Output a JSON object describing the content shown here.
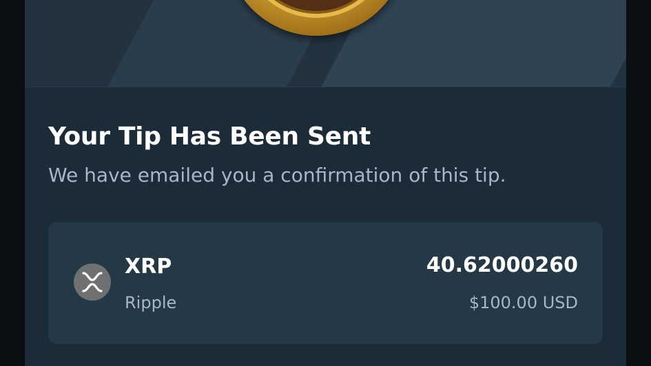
{
  "confirmation": {
    "title": "Your Tip Has Been Sent",
    "message": "We have emailed you a confirmation of this tip."
  },
  "tip": {
    "asset_symbol": "XRP",
    "asset_name": "Ripple",
    "icon": "xrp-icon",
    "amount": "40.62000260",
    "amount_usd": "$100.00 USD"
  },
  "colors": {
    "background": "#1c2b38",
    "card": "#253846",
    "primary_text": "#ffffff",
    "secondary_text": "#a9b6c8",
    "coin_gold": "#d9a636"
  }
}
